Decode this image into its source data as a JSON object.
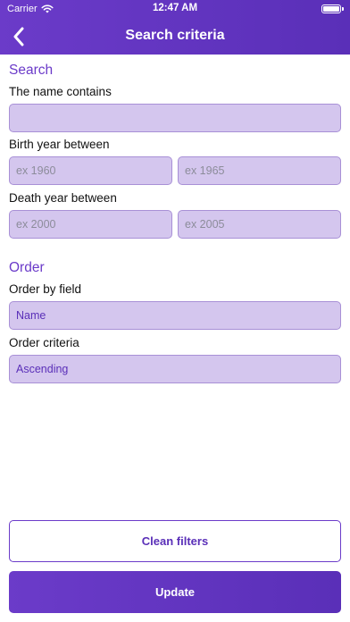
{
  "status_bar": {
    "carrier": "Carrier",
    "time": "12:47 AM"
  },
  "nav": {
    "title": "Search criteria",
    "back_icon": "chevron-left-icon"
  },
  "search": {
    "section_title": "Search",
    "name_label": "The name contains",
    "name_value": "",
    "birth_label": "Birth year between",
    "birth_from_placeholder": "ex 1960",
    "birth_to_placeholder": "ex 1965",
    "death_label": "Death year between",
    "death_from_placeholder": "ex 2000",
    "death_to_placeholder": "ex 2005"
  },
  "order": {
    "section_title": "Order",
    "field_label": "Order by field",
    "field_value": "Name",
    "criteria_label": "Order criteria",
    "criteria_value": "Ascending"
  },
  "actions": {
    "clean_label": "Clean filters",
    "update_label": "Update"
  },
  "colors": {
    "accent": "#6b3bc9",
    "field_bg": "#d4c6ee"
  }
}
